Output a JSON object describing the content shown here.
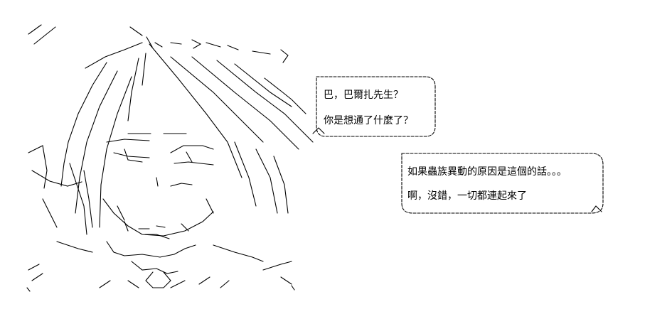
{
  "bubble_left": {
    "line1": "巴，巴爾扎先生？",
    "line2": "你是想通了什麼了？"
  },
  "bubble_right": {
    "line1": "如果蟲族異動的原因是這個的話。。。",
    "line2": "啊，沒錯，一切都連起來了"
  },
  "colors": {
    "ink": "#000000",
    "paper": "#ffffff"
  }
}
